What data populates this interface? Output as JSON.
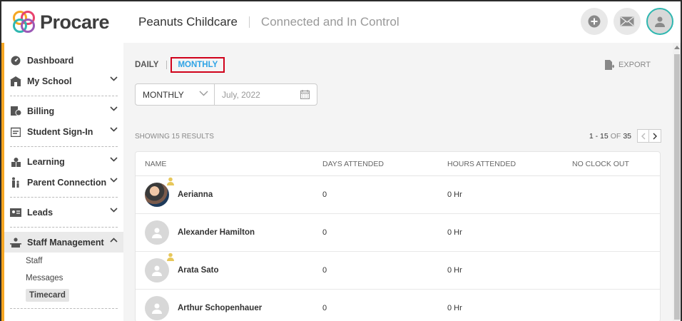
{
  "header": {
    "brand": "Procare",
    "school_name": "Peanuts Childcare",
    "tagline": "Connected and In Control"
  },
  "sidebar": {
    "items": [
      {
        "label": "Dashboard",
        "icon": "dashboard-icon"
      },
      {
        "label": "My School",
        "icon": "school-icon"
      },
      {
        "label": "Billing",
        "icon": "billing-icon"
      },
      {
        "label": "Student Sign-In",
        "icon": "sign-in-icon"
      },
      {
        "label": "Learning",
        "icon": "learning-icon"
      },
      {
        "label": "Parent Connection",
        "icon": "parent-icon"
      },
      {
        "label": "Leads",
        "icon": "leads-icon"
      },
      {
        "label": "Staff Management",
        "icon": "staff-icon"
      }
    ],
    "sub_items": [
      "Staff",
      "Messages",
      "Timecard"
    ]
  },
  "tabs": {
    "daily": "DAILY",
    "monthly": "MONTHLY"
  },
  "export_label": "EXPORT",
  "filter": {
    "period": "MONTHLY",
    "date": "July, 2022"
  },
  "results_label": "SHOWING 15 RESULTS",
  "pager": {
    "range": "1 - 15",
    "of": "OF",
    "total": "35"
  },
  "table": {
    "headers": [
      "NAME",
      "DAYS ATTENDED",
      "HOURS ATTENDED",
      "NO CLOCK OUT"
    ],
    "rows": [
      {
        "name": "Aerianna",
        "days": "0",
        "hours": "0 Hr",
        "no_clock_out": ""
      },
      {
        "name": "Alexander Hamilton",
        "days": "0",
        "hours": "0 Hr",
        "no_clock_out": ""
      },
      {
        "name": "Arata Sato",
        "days": "0",
        "hours": "0 Hr",
        "no_clock_out": ""
      },
      {
        "name": "Arthur Schopenhauer",
        "days": "0",
        "hours": "0 Hr",
        "no_clock_out": ""
      }
    ]
  },
  "colors": {
    "accent": "#2ea3e5",
    "sidebar_stripe": "#f5a623",
    "highlight_box": "#d0021b"
  }
}
